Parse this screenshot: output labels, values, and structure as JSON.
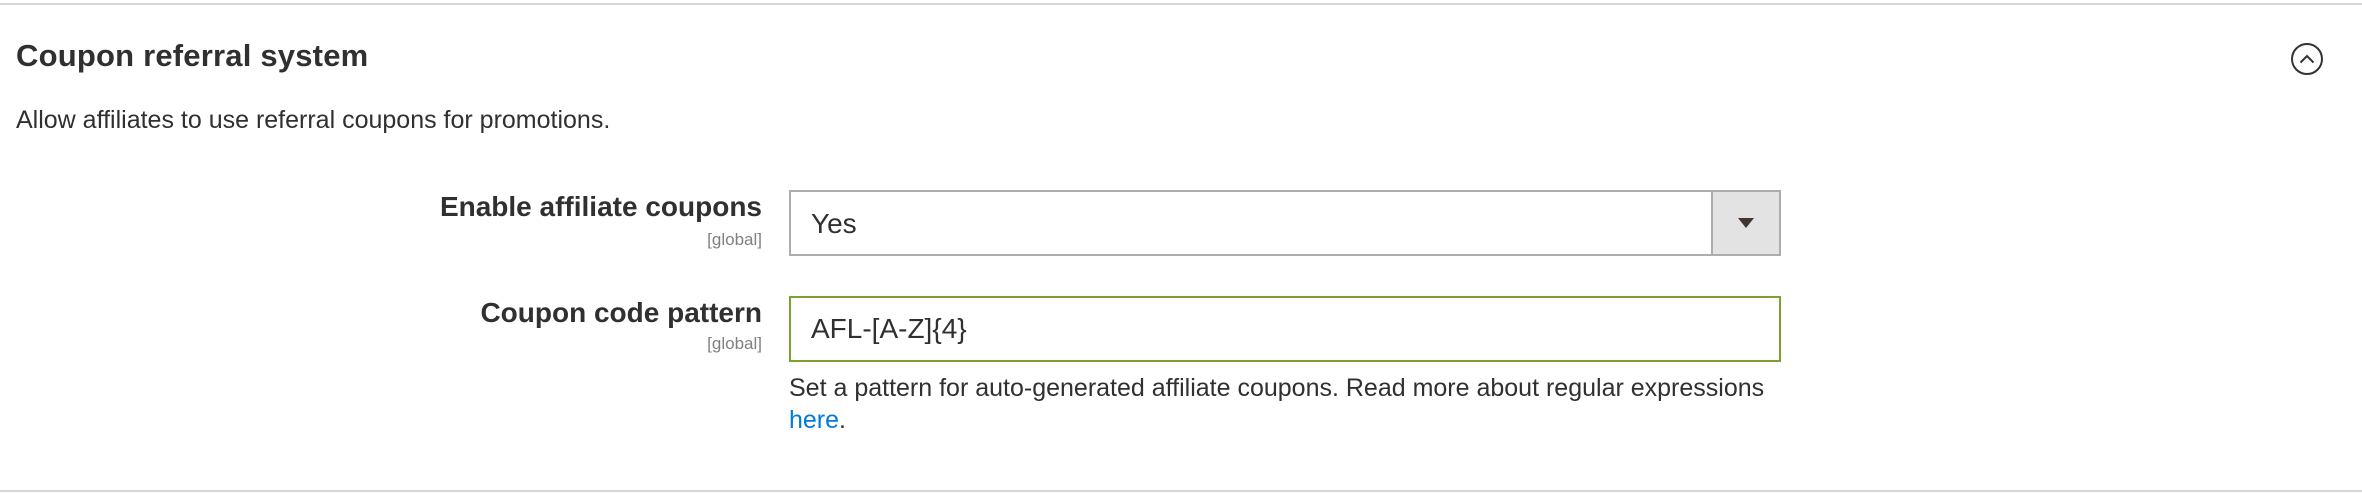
{
  "section": {
    "title": "Coupon referral system",
    "description": "Allow affiliates to use referral coupons for promotions.",
    "collapse_icon": "chevron-up-circle-icon"
  },
  "fields": {
    "enable_coupons": {
      "label": "Enable affiliate coupons",
      "scope": "[global]",
      "value": "Yes",
      "arrow_icon": "caret-down-icon"
    },
    "code_pattern": {
      "label": "Coupon code pattern",
      "scope": "[global]",
      "value": "AFL-[A-Z]{4}",
      "note_text": "Set a pattern for auto-generated affiliate coupons. Read more about regular expressions",
      "note_link": "here",
      "note_end": "."
    }
  },
  "colors": {
    "link": "#007bdb",
    "valid_border": "#79a22e",
    "divider": "#d6d6d6"
  }
}
